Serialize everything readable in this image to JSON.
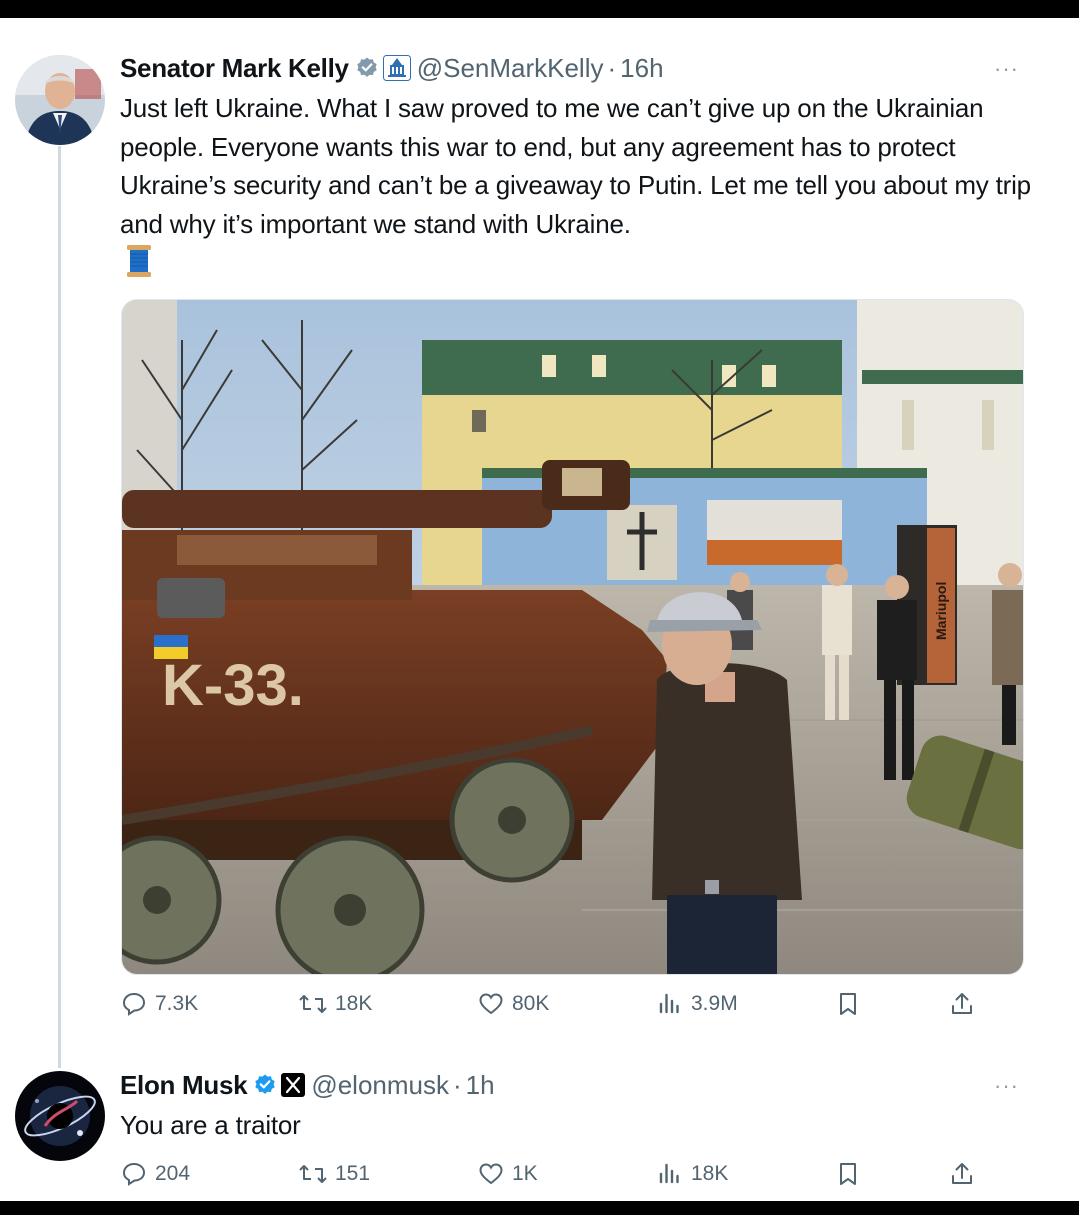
{
  "tweet": {
    "author_name": "Senator Mark Kelly",
    "handle": "@SenMarkKelly",
    "time_sep": "·",
    "time": "16h",
    "more": "···",
    "text": "Just left Ukraine. What I saw proved to me we can’t give up on the Ukrainian people. Everyone wants this war to end, but any agreement has to protect Ukraine’s security and can’t be a giveaway to Putin. Let me tell you about my trip and why it’s important we stand with Ukraine.",
    "emoji_icon": "thread-spool-icon",
    "badges": [
      "gray-verified-icon",
      "capitol-icon"
    ],
    "media": {
      "sign_text": "Mariupol",
      "tank_text": "K-33."
    },
    "stats": {
      "replies": "7.3K",
      "reposts": "18K",
      "likes": "80K",
      "views": "3.9M"
    }
  },
  "reply": {
    "author_name": "Elon Musk",
    "handle": "@elonmusk",
    "time_sep": "·",
    "time": "1h",
    "more": "···",
    "text": "You are a traitor",
    "badges": [
      "blue-verified-icon",
      "x-logo-icon"
    ],
    "stats": {
      "replies": "204",
      "reposts": "151",
      "likes": "1K",
      "views": "18K"
    }
  },
  "colors": {
    "verified_blue": "#1d9bf0",
    "verified_gray": "#829aab",
    "muted_text": "#536471",
    "thread_line": "#cfd9de"
  }
}
